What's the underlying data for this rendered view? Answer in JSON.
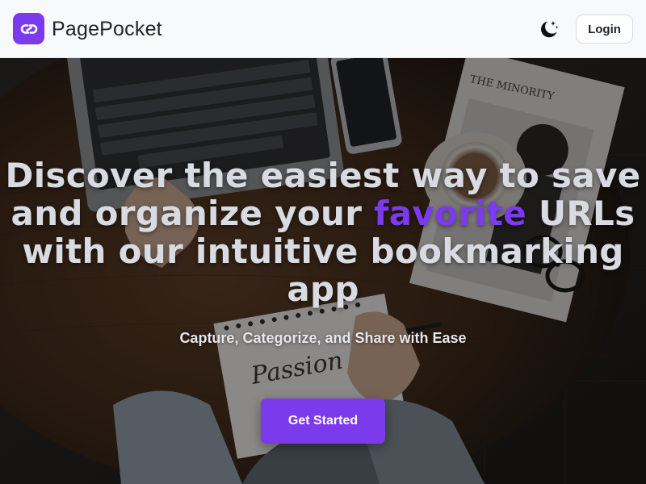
{
  "header": {
    "brand_name": "PagePocket",
    "logo_icon": "link-icon",
    "theme_toggle_icon": "moon-stars-icon",
    "login_label": "Login"
  },
  "hero": {
    "headline_before": "Discover the easiest way to save and organize your ",
    "headline_accent": "favorite",
    "headline_after": " URLs with our intuitive bookmarking app",
    "tagline": "Capture, Categorize, and Share with Ease",
    "cta_label": "Get Started",
    "notebook_lettering": "Passion",
    "magazine_title": "THE MINORITY",
    "background_image": "desk-scene-laptop-coffee-notebook"
  },
  "colors": {
    "accent": "#7c3aed",
    "header_bg": "#f8f9fb",
    "headline_text": "#d9dbe2",
    "brand_text": "#1f2330"
  }
}
